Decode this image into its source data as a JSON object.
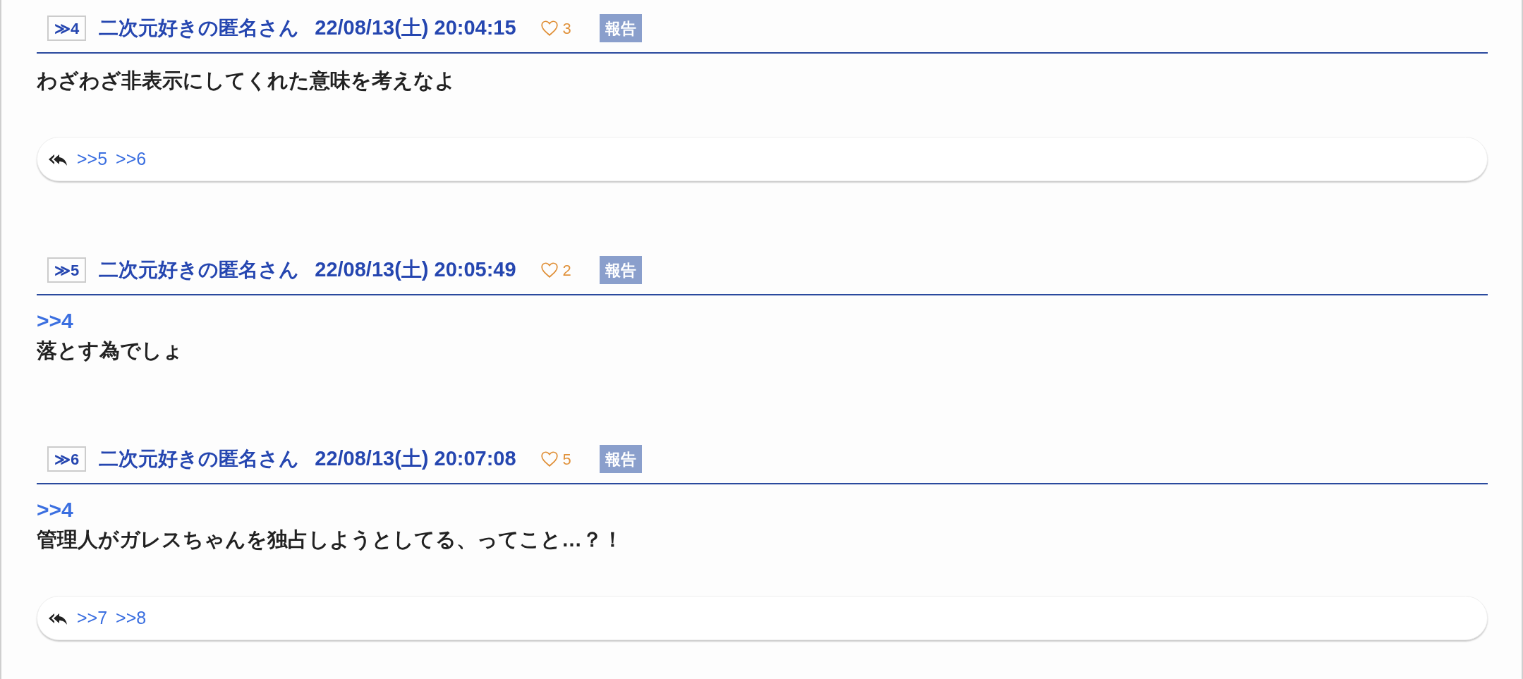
{
  "posts": [
    {
      "number": "≫4",
      "name": "二次元好きの匿名さん",
      "date": "22/08/13(土) 20:04:15",
      "likes": "3",
      "report": "報告",
      "text": "わざわざ非表示にしてくれた意味を考えなよ",
      "replies": [
        ">>5",
        ">>6"
      ]
    },
    {
      "number": "≫5",
      "name": "二次元好きの匿名さん",
      "date": "22/08/13(土) 20:05:49",
      "likes": "2",
      "report": "報告",
      "anchor": ">>4",
      "text": "落とす為でしょ"
    },
    {
      "number": "≫6",
      "name": "二次元好きの匿名さん",
      "date": "22/08/13(土) 20:07:08",
      "likes": "5",
      "report": "報告",
      "anchor": ">>4",
      "text": "管理人がガレスちゃんを独占しようとしてる、ってこと…？！",
      "replies": [
        ">>7",
        ">>8"
      ]
    }
  ]
}
